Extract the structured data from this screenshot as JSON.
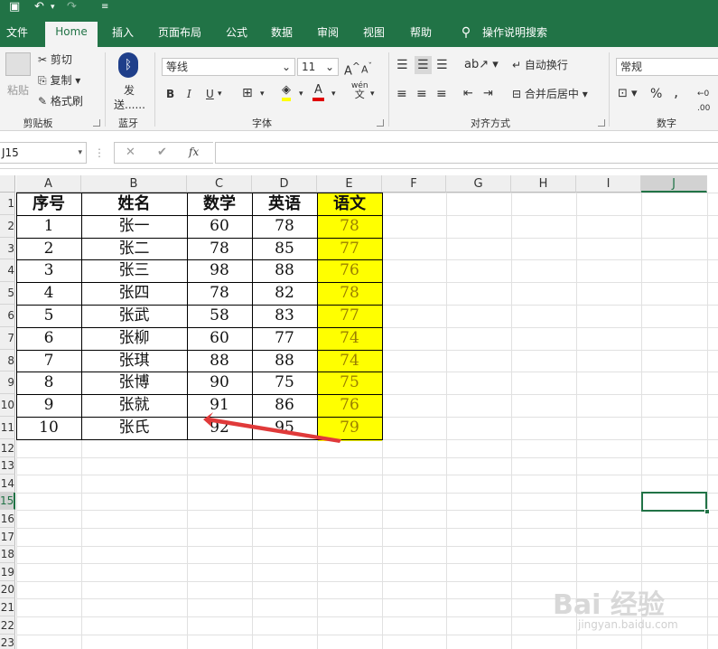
{
  "quick_access": {
    "save_icon": "save-icon",
    "undo_icon": "undo-icon",
    "redo_icon": "redo-icon",
    "customize_icon": "customize-icon"
  },
  "tabs": [
    "文件",
    "Home",
    "插入",
    "页面布局",
    "公式",
    "数据",
    "审阅",
    "视图",
    "帮助"
  ],
  "active_tab": "Home",
  "tell_me": "操作说明搜索",
  "ribbon": {
    "clipboard": {
      "paste": "粘贴",
      "cut": "剪切",
      "copy": "复制",
      "format_painter": "格式刷",
      "label": "剪贴板"
    },
    "bluetooth": {
      "send_line1": "发",
      "send_line2": "送......",
      "label": "蓝牙"
    },
    "font": {
      "name": "等线",
      "size": "11",
      "bold": "B",
      "italic": "I",
      "underline": "U",
      "wen": "wén",
      "wen2": "文",
      "label": "字体"
    },
    "alignment": {
      "wrap": "自动换行",
      "merge": "合并后居中",
      "label": "对齐方式"
    },
    "number": {
      "format": "常规",
      "percent": "%",
      "comma": ",",
      "label": "数字"
    }
  },
  "name_box": "J15",
  "formula_bar": {
    "cancel": "✕",
    "enter": "✔",
    "fx": "fx",
    "content": ""
  },
  "colors": {
    "brand": "#217346",
    "highlight": "#ffff00",
    "arrow": "#e03a3a"
  },
  "columns": [
    "A",
    "B",
    "C",
    "D",
    "E",
    "F",
    "G",
    "H",
    "I",
    "J"
  ],
  "selected_column": "J",
  "selected_row": "15",
  "rows": [
    "1",
    "2",
    "3",
    "4",
    "5",
    "6",
    "7",
    "8",
    "9",
    "10",
    "11",
    "12",
    "13",
    "14",
    "15",
    "16",
    "17",
    "18",
    "19",
    "20",
    "21",
    "22",
    "23"
  ],
  "table": {
    "headers": [
      "序号",
      "姓名",
      "数学",
      "英语",
      "语文"
    ],
    "rows": [
      [
        "1",
        "张一",
        "60",
        "78",
        "78"
      ],
      [
        "2",
        "张二",
        "78",
        "85",
        "77"
      ],
      [
        "3",
        "张三",
        "98",
        "88",
        "76"
      ],
      [
        "4",
        "张四",
        "78",
        "82",
        "78"
      ],
      [
        "5",
        "张武",
        "58",
        "83",
        "77"
      ],
      [
        "6",
        "张柳",
        "60",
        "77",
        "74"
      ],
      [
        "7",
        "张琪",
        "88",
        "88",
        "74"
      ],
      [
        "8",
        "张博",
        "90",
        "75",
        "75"
      ],
      [
        "9",
        "张就",
        "91",
        "86",
        "76"
      ],
      [
        "10",
        "张氏",
        "92",
        "95",
        "79"
      ]
    ]
  },
  "watermark": {
    "line1": "Bai 经验",
    "line2": "jingyan.baidu.com"
  }
}
